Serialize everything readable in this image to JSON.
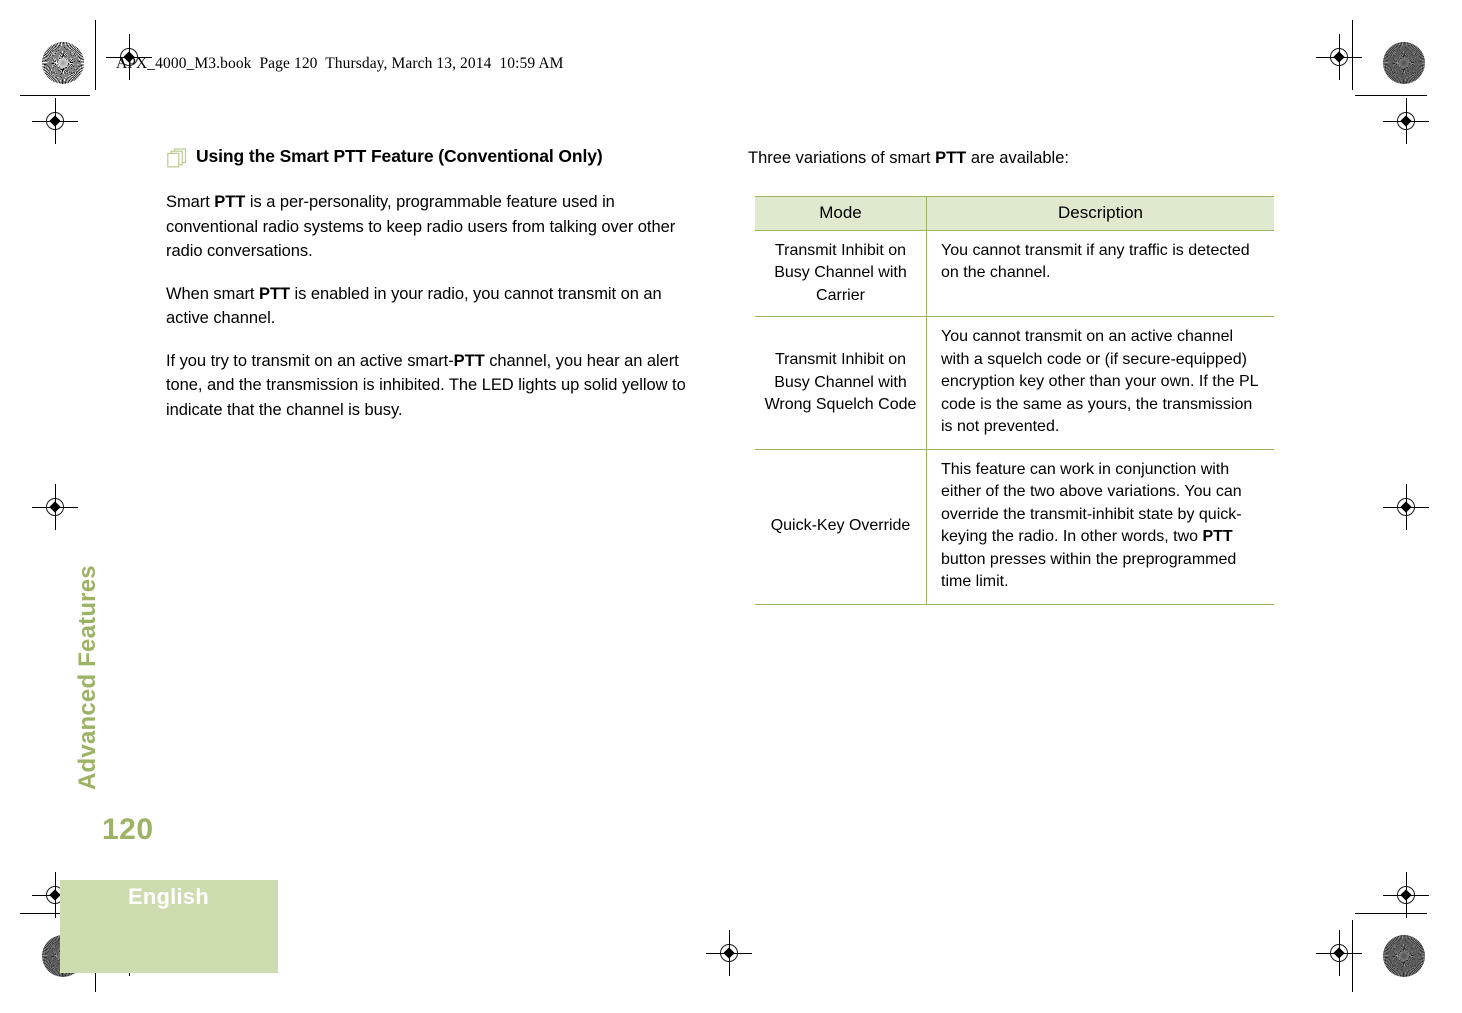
{
  "print_slug": "APX_4000_M3.book  Page 120  Thursday, March 13, 2014  10:59 AM",
  "side_tab": {
    "label": "Advanced Features"
  },
  "footer": {
    "page_number": "120",
    "language": "English"
  },
  "left_column": {
    "heading_icon": "stacked-pages-icon",
    "heading": "Using the Smart PTT Feature (Conventional Only)",
    "paragraphs": [
      {
        "segments": [
          {
            "text": "Smart ",
            "bold": false
          },
          {
            "text": "PTT",
            "bold": true
          },
          {
            "text": " is a per-personality, programmable feature used in conventional radio systems to keep radio users from talking over other radio conversations.",
            "bold": false
          }
        ]
      },
      {
        "segments": [
          {
            "text": "When smart ",
            "bold": false
          },
          {
            "text": "PTT",
            "bold": true
          },
          {
            "text": " is enabled in your radio, you cannot transmit on an active channel.",
            "bold": false
          }
        ]
      },
      {
        "segments": [
          {
            "text": "If you try to transmit on an active smart-",
            "bold": false
          },
          {
            "text": "PTT",
            "bold": true
          },
          {
            "text": " channel, you hear an alert tone, and the transmission is inhibited. The LED lights up solid yellow to indicate that the channel is busy.",
            "bold": false
          }
        ]
      }
    ]
  },
  "right_column": {
    "intro": {
      "segments": [
        {
          "text": "Three variations of smart ",
          "bold": false
        },
        {
          "text": "PTT",
          "bold": true
        },
        {
          "text": " are available:",
          "bold": false
        }
      ]
    },
    "table": {
      "headers": [
        "Mode",
        "Description"
      ],
      "rows": [
        {
          "mode": "Transmit Inhibit on Busy Channel with Carrier",
          "description_segments": [
            {
              "text": "You cannot transmit if any traffic is detected on the channel.",
              "bold": false
            }
          ]
        },
        {
          "mode": "Transmit Inhibit on Busy Channel with Wrong Squelch Code",
          "description_segments": [
            {
              "text": "You cannot transmit on an active channel with a squelch code or (if secure-equipped) encryption key other than your own. If the PL code is the same as yours, the transmission is not prevented.",
              "bold": false
            }
          ]
        },
        {
          "mode": "Quick-Key Override",
          "description_segments": [
            {
              "text": "This feature can work in conjunction with either of the two above variations. You can override the transmit-inhibit state by quick-keying the radio. In other words, two ",
              "bold": false
            },
            {
              "text": "PTT",
              "bold": true
            },
            {
              "text": " button presses within the preprogrammed time limit.",
              "bold": false
            }
          ]
        }
      ]
    }
  },
  "colors": {
    "accent_green": "#9cb264",
    "table_header_green": "#dfe9cd",
    "footer_block_green": "#ccdcae",
    "text_black": "#000000"
  }
}
